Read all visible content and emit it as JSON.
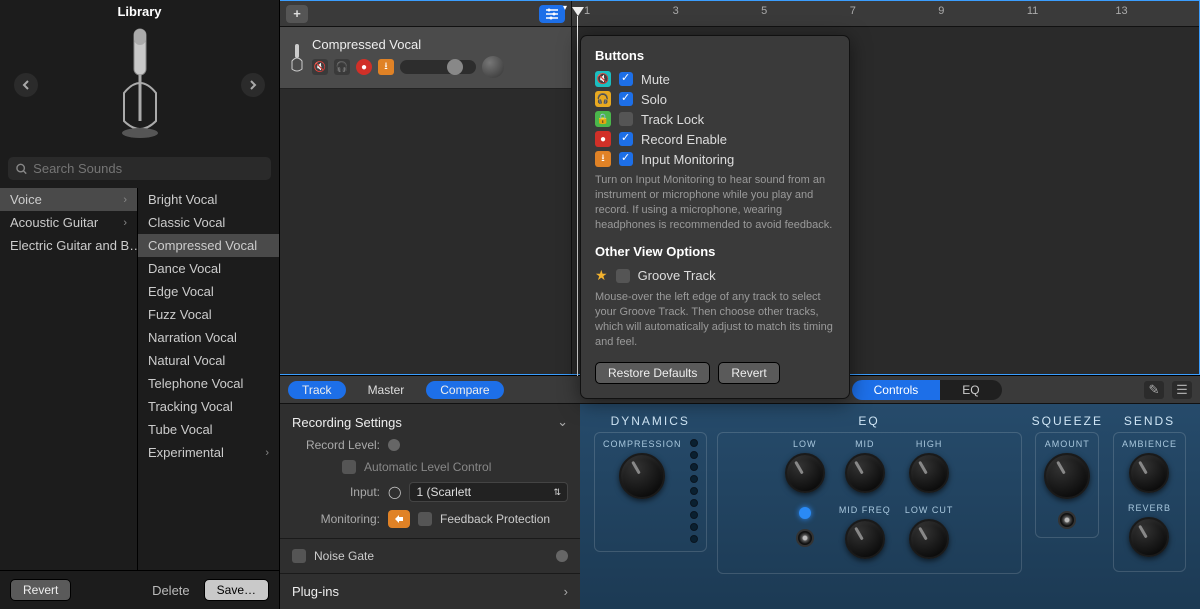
{
  "library": {
    "title": "Library",
    "search_placeholder": "Search Sounds",
    "categories": [
      {
        "label": "Voice",
        "chev": true,
        "selected": true
      },
      {
        "label": "Acoustic Guitar",
        "chev": true,
        "selected": false
      },
      {
        "label": "Electric Guitar and B…",
        "chev": true,
        "selected": false
      }
    ],
    "presets": [
      "Bright Vocal",
      "Classic Vocal",
      "Compressed Vocal",
      "Dance Vocal",
      "Edge Vocal",
      "Fuzz Vocal",
      "Narration Vocal",
      "Natural Vocal",
      "Telephone Vocal",
      "Tracking Vocal",
      "Tube Vocal",
      "Experimental"
    ],
    "preset_selected_index": 2,
    "preset_chev_index": 11,
    "revert": "Revert",
    "delete": "Delete",
    "save": "Save…"
  },
  "track": {
    "name": "Compressed Vocal"
  },
  "ruler_ticks": [
    "1",
    "3",
    "5",
    "7",
    "9",
    "11",
    "13"
  ],
  "popover": {
    "h_buttons": "Buttons",
    "rows": [
      {
        "icon": "teal",
        "glyph": "🔇",
        "checked": true,
        "label": "Mute"
      },
      {
        "icon": "yellow",
        "glyph": "🎧",
        "checked": true,
        "label": "Solo"
      },
      {
        "icon": "green",
        "glyph": "🔒",
        "checked": false,
        "label": "Track Lock"
      },
      {
        "icon": "red",
        "glyph": "●",
        "checked": true,
        "label": "Record Enable"
      },
      {
        "icon": "orange",
        "glyph": "⭳",
        "checked": true,
        "label": "Input Monitoring"
      }
    ],
    "desc1": "Turn on Input Monitoring to hear sound from an instrument or microphone while you play and record. If using a microphone, wearing headphones is recommended to avoid feedback.",
    "h_other": "Other View Options",
    "groove_label": "Groove Track",
    "groove_checked": false,
    "desc2": "Mouse-over the left edge of any track to select your Groove Track. Then choose other tracks, which will automatically adjust to match its timing and feel.",
    "restore": "Restore Defaults",
    "revert": "Revert"
  },
  "sc": {
    "track": "Track",
    "master": "Master",
    "compare": "Compare",
    "controls": "Controls",
    "eq": "EQ"
  },
  "inspector": {
    "recording_settings": "Recording Settings",
    "record_level": "Record Level:",
    "auto_level": "Automatic Level Control",
    "input_label": "Input:",
    "input_value": "1  (Scarlett",
    "monitoring": "Monitoring:",
    "feedback_protection": "Feedback Protection",
    "noise_gate": "Noise Gate",
    "plugins": "Plug-ins"
  },
  "rack": {
    "dynamics": {
      "title": "DYNAMICS",
      "k1": "COMPRESSION"
    },
    "eq": {
      "title": "EQ",
      "low": "LOW",
      "mid": "MID",
      "high": "HIGH",
      "midfreq": "MID FREQ",
      "lowcut": "LOW CUT"
    },
    "squeeze": {
      "title": "SQUEEZE",
      "amount": "AMOUNT"
    },
    "sends": {
      "title": "SENDS",
      "ambience": "AMBIENCE",
      "reverb": "REVERB"
    }
  }
}
